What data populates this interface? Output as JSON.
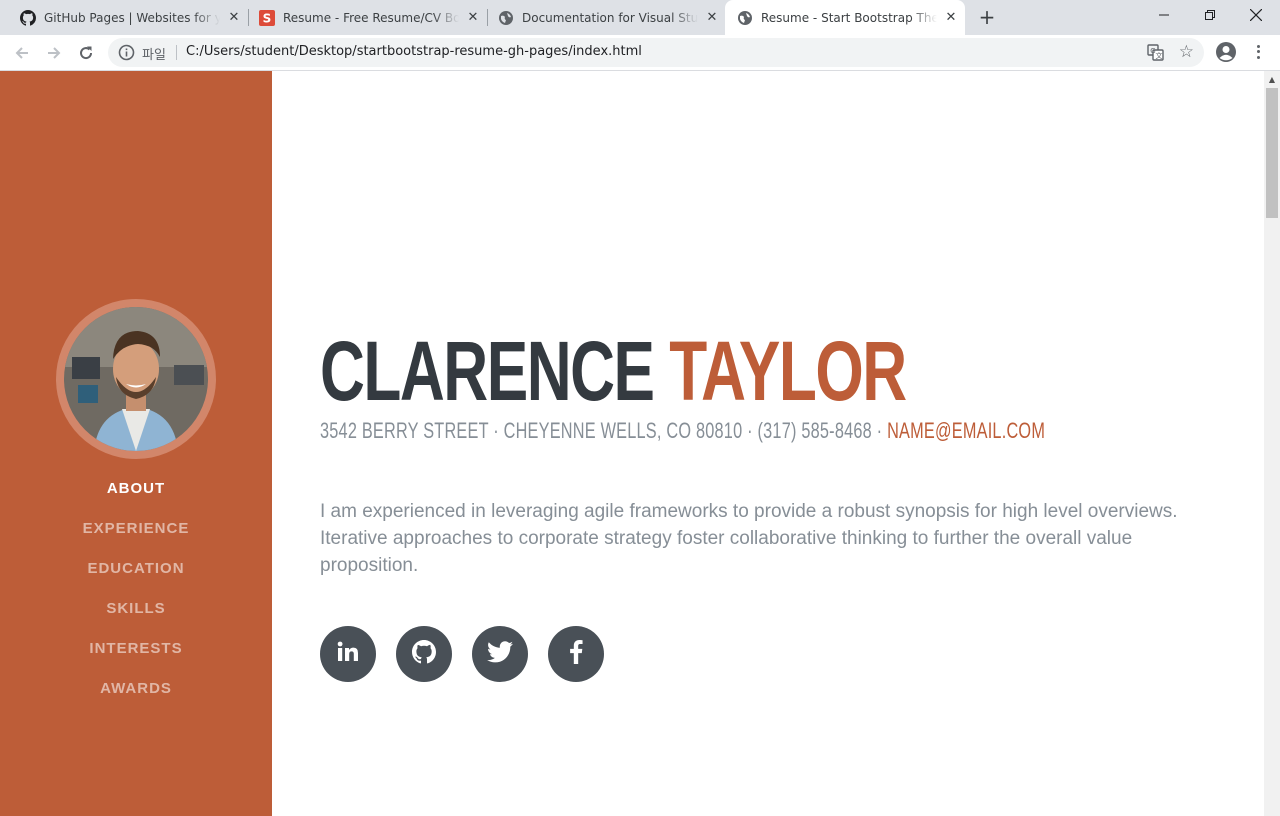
{
  "browser": {
    "tabs": [
      {
        "title": "GitHub Pages | Websites for you and your projects",
        "icon": "github-icon"
      },
      {
        "title": "Resume - Free Resume/CV Bootstrap Theme",
        "icon": "startbootstrap-icon"
      },
      {
        "title": "Documentation for Visual Studio Code",
        "icon": "globe-icon"
      },
      {
        "title": "Resume - Start Bootstrap Theme",
        "icon": "globe-icon",
        "active": true
      }
    ],
    "scheme_label": "파일",
    "url": "C:/Users/student/Desktop/startbootstrap-resume-gh-pages/index.html"
  },
  "sidebar": {
    "nav": [
      "About",
      "Experience",
      "Education",
      "Skills",
      "Interests",
      "Awards"
    ],
    "active": "About"
  },
  "about": {
    "first_name": "Clarence",
    "last_name": "Taylor",
    "address": "3542 Berry Street · Cheyenne Wells, CO 80810 · (317) 585-8468 · ",
    "email": "name@email.com",
    "lead": "I am experienced in leveraging agile frameworks to provide a robust synopsis for high level overviews. Iterative approaches to corporate strategy foster collaborative thinking to further the overall value proposition.",
    "social": [
      "linkedin-icon",
      "github-icon",
      "twitter-icon",
      "facebook-icon"
    ]
  },
  "colors": {
    "primary": "#bd5d38",
    "dark": "#343a40",
    "muted": "#868e96",
    "social_bg": "#495057"
  }
}
